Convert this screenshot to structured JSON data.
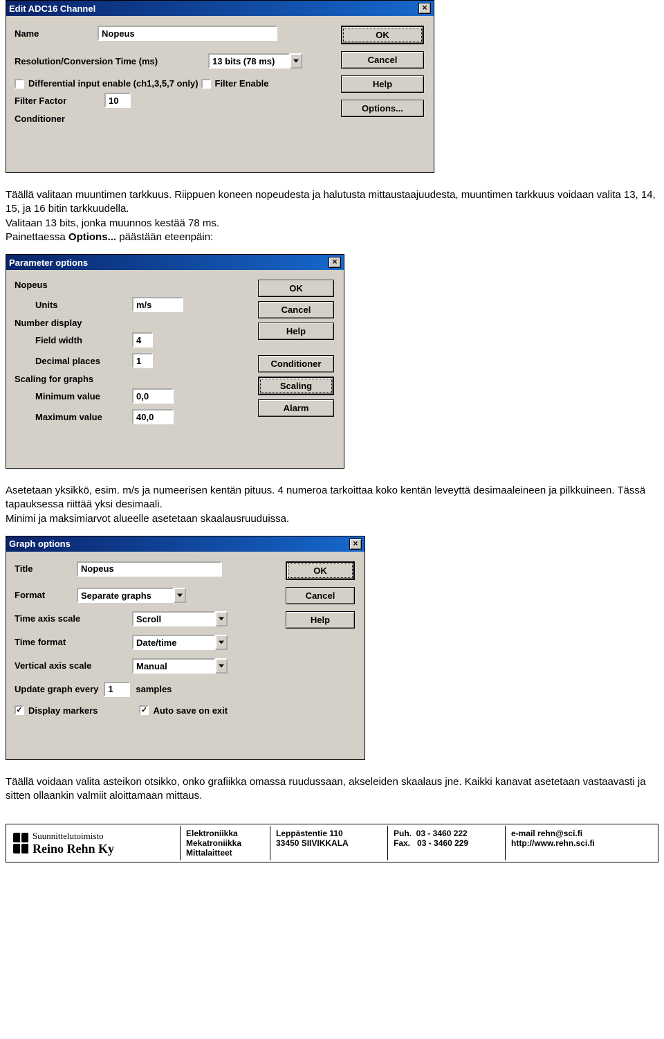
{
  "dialog1": {
    "title": "Edit ADC16 Channel",
    "name_label": "Name",
    "name_value": "Nopeus",
    "res_label": "Resolution/Conversion Time (ms)",
    "res_value": "13 bits (78 ms)",
    "diff_label": "Differential input enable (ch1,3,5,7 only)",
    "filter_enable_label": "Filter Enable",
    "filter_factor_label": "Filter Factor",
    "filter_factor_value": "10",
    "conditioner_label": "Conditioner",
    "btn_ok": "OK",
    "btn_cancel": "Cancel",
    "btn_help": "Help",
    "btn_options": "Options..."
  },
  "para1": "Täällä valitaan muuntimen tarkkuus. Riippuen koneen nopeudesta ja halutusta mittaustaajuudesta, muuntimen tarkkuus voidaan valita 13, 14, 15, ja 16 bitin tarkkuudella.\nValitaan 13 bits, jonka muunnos kestää 78 ms.\nPainettaessa ",
  "para1b": "Options...",
  "para1c": " päästään eteenpäin:",
  "dialog2": {
    "title": "Parameter options",
    "section": "Nopeus",
    "units_label": "Units",
    "units_value": "m/s",
    "numdisp_label": "Number display",
    "fieldwidth_label": "Field width",
    "fieldwidth_value": "4",
    "decplaces_label": "Decimal places",
    "decplaces_value": "1",
    "scaling_label": "Scaling for graphs",
    "minval_label": "Minimum value",
    "minval_value": "0,0",
    "maxval_label": "Maximum value",
    "maxval_value": "40,0",
    "btn_ok": "OK",
    "btn_cancel": "Cancel",
    "btn_help": "Help",
    "btn_conditioner": "Conditioner",
    "btn_scaling": "Scaling",
    "btn_alarm": "Alarm"
  },
  "para2": "Asetetaan yksikkö, esim. m/s ja numeerisen kentän pituus. 4 numeroa tarkoittaa koko kentän leveyttä desimaaleineen ja pilkkuineen. Tässä tapauksessa riittää yksi desimaali.\nMinimi ja maksimiarvot alueelle asetetaan skaalausruuduissa.",
  "dialog3": {
    "title": "Graph options",
    "title_label": "Title",
    "title_value": "Nopeus",
    "format_label": "Format",
    "format_value": "Separate graphs",
    "timeaxis_label": "Time axis scale",
    "timeaxis_value": "Scroll",
    "timefmt_label": "Time format",
    "timefmt_value": "Date/time",
    "vaxis_label": "Vertical axis scale",
    "vaxis_value": "Manual",
    "update_label_pre": "Update graph every",
    "update_value": "1",
    "update_label_post": "samples",
    "chk_markers": "Display markers",
    "chk_autosave": "Auto save on exit",
    "btn_ok": "OK",
    "btn_cancel": "Cancel",
    "btn_help": "Help"
  },
  "para3": "Täällä voidaan valita asteikon otsikko, onko grafiikka omassa ruudussaan, akseleiden skaalaus jne. Kaikki kanavat asetetaan vastaavasti ja sitten ollaankin valmiit aloittamaan mittaus.",
  "footer": {
    "company1": "Suunnittelutoimisto",
    "company2": "Reino Rehn Ky",
    "col2a": "Elektroniikka",
    "col2b": "Mekatroniikka",
    "col2c": "Mittalaitteet",
    "addr1": "Leppästentie 110",
    "addr2": "33450 SIIVIKKALA",
    "phone_lbl": "Puh.",
    "phone": "03 - 3460 222",
    "fax_lbl": "Fax.",
    "fax": "03 - 3460 229",
    "email_lbl": "e-mail",
    "email": "rehn@sci.fi",
    "url": "http://www.rehn.sci.fi"
  }
}
